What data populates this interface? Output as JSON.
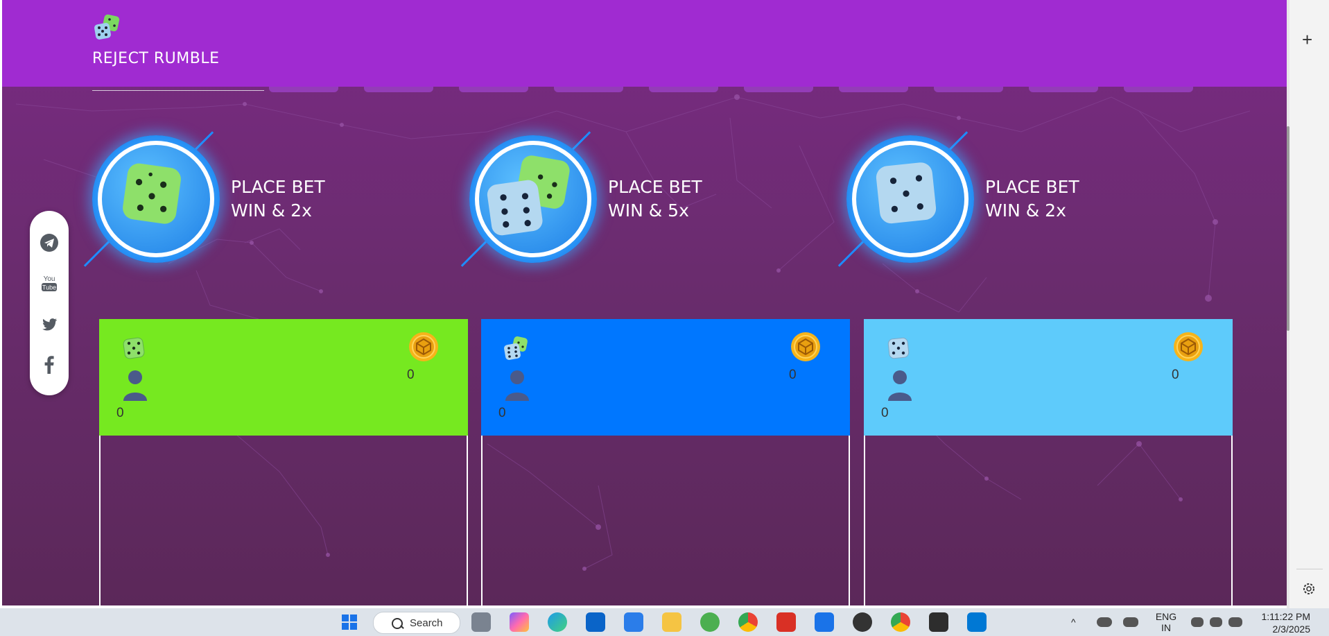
{
  "app": {
    "brand": "REJECT RUMBLE"
  },
  "bets": [
    {
      "line1": "PLACE BET",
      "line2": "WIN & 2x",
      "dice": "green-die"
    },
    {
      "line1": "PLACE BET",
      "line2": "WIN & 5x",
      "dice": "two-dice"
    },
    {
      "line1": "PLACE BET",
      "line2": "WIN & 2x",
      "dice": "blue-die"
    }
  ],
  "cards": [
    {
      "color": "#76e920",
      "coin_value": "0",
      "user_count": "0",
      "icon": "green-die-icon"
    },
    {
      "color": "#0077ff",
      "coin_value": "0",
      "user_count": "0",
      "icon": "two-dice-icon"
    },
    {
      "color": "#5ecbfb",
      "coin_value": "0",
      "user_count": "0",
      "icon": "blue-die-icon"
    }
  ],
  "social": [
    "telegram-icon",
    "youtube-icon",
    "twitter-icon",
    "facebook-icon"
  ],
  "social_youtube_text": {
    "you": "You",
    "tube": "Tube"
  },
  "taskbar": {
    "search_label": "Search",
    "lang_line1": "ENG",
    "lang_line2": "IN",
    "time": "1:11:22 PM",
    "date": "2/3/2025"
  },
  "colors": {
    "header": "#a02bd1",
    "page_bg": "#6a2c6e",
    "accent_blue": "#1e8cff"
  }
}
